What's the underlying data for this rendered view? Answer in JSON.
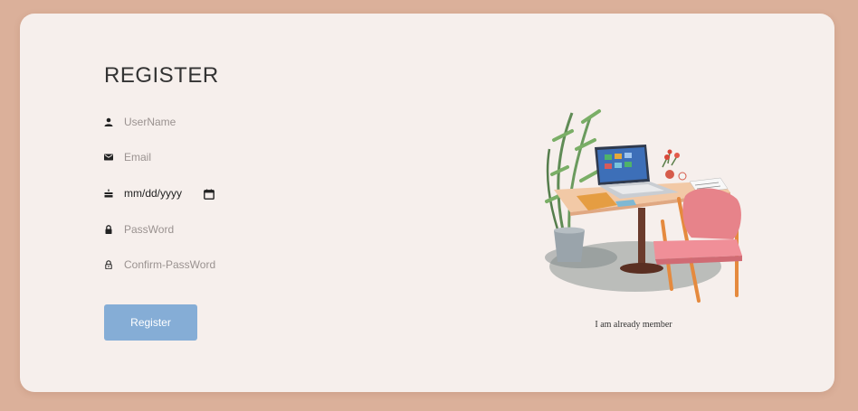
{
  "form": {
    "title": "REGISTER",
    "username_placeholder": "UserName",
    "email_placeholder": "Email",
    "date_value": "mm/dd/yyyy",
    "password_placeholder": "PassWord",
    "confirm_placeholder": "Confirm-PassWord",
    "submit_label": "Register"
  },
  "aside": {
    "member_link": "I am already member"
  },
  "icons": {
    "user": "person-icon",
    "email": "envelope-icon",
    "date": "cake-icon",
    "password": "lock-icon",
    "confirm": "lock-open-icon",
    "calendar": "calendar-icon"
  },
  "colors": {
    "background": "#dbb09a",
    "card": "#f6efec",
    "button": "#85add6",
    "text": "#333333"
  }
}
